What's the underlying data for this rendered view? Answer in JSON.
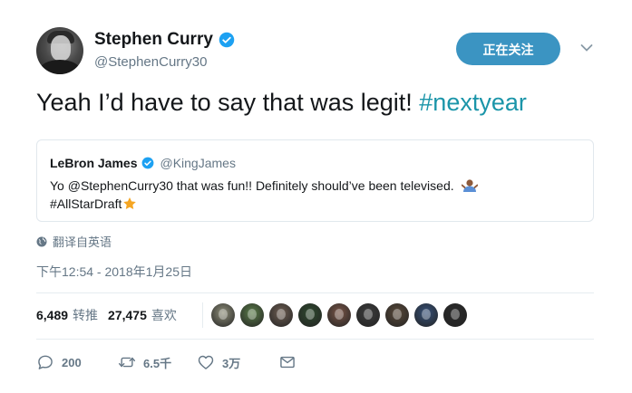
{
  "author": {
    "display_name": "Stephen Curry",
    "handle": "@StephenCurry30",
    "verified": true
  },
  "follow_button_label": "正在关注",
  "tweet": {
    "text": "Yeah I’d have to say that was legit! ",
    "hashtag": "#nextyear"
  },
  "quoted_tweet": {
    "display_name": "LeBron James",
    "handle": "@KingJames",
    "line1": "Yo @StephenCurry30 that was fun!! Definitely should’ve been televised.",
    "line2": "#AllStarDraft"
  },
  "translate_label": "翻译自英语",
  "timestamp": "下午12:54 - 2018年1月25日",
  "stats": {
    "retweets_count": "6,489",
    "retweets_label": "转推",
    "likes_count": "27,475",
    "likes_label": "喜欢"
  },
  "liker_avatar_colors": [
    "#8f8f7a",
    "#5b7d4a",
    "#6e5e52",
    "#2f4a2f",
    "#7a5648",
    "#3d3d3d",
    "#5a4a3a",
    "#37527a",
    "#2b2b2b"
  ],
  "actions": {
    "reply_count": "200",
    "retweet_count": "6.5千",
    "like_count": "3万"
  },
  "colors": {
    "accent": "#1b95a9",
    "follow_button": "#3b94c2",
    "verified": "#1da1f2",
    "secondary_text": "#657786"
  }
}
